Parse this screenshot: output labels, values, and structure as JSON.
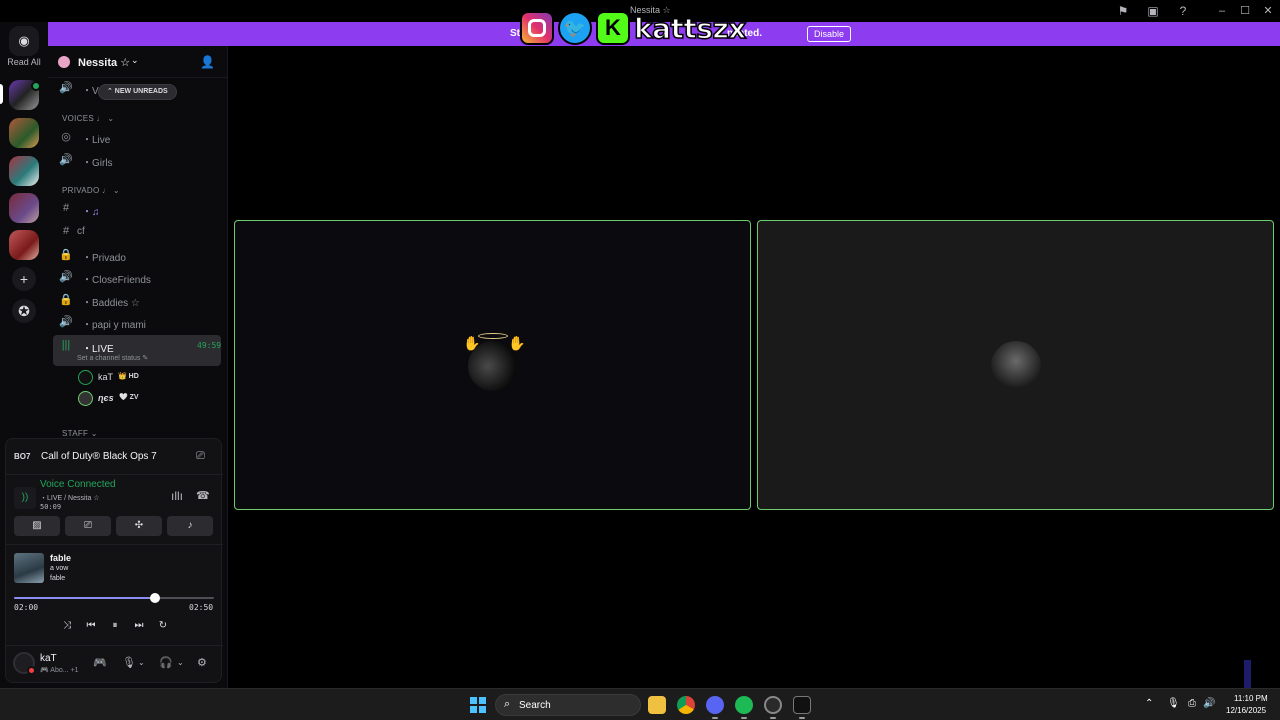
{
  "window": {
    "title": "Nessita ☆"
  },
  "notice": {
    "text_start": "St",
    "text_end": "ncated.",
    "disable_label": "Disable",
    "close_icon": "×"
  },
  "overlay": {
    "name": "kattszx",
    "kick_letter": "K",
    "twitter_icon": "bird-icon",
    "instagram_icon": "camera-icon"
  },
  "rail": {
    "read_all": "Read All",
    "add_icon": "+",
    "discover_icon": "✪"
  },
  "server": {
    "name": "Nessita",
    "star": "☆"
  },
  "new_unreads": "⌃ NEW UNREADS",
  "channels": {
    "vo": "・Vo",
    "voices_cat": "VOICES ♩ ⌄",
    "live_stage": "・Live",
    "girls": "・Girls",
    "privado_cat": "PRIVADO ♩ ⌄",
    "music": "・♫",
    "cf": "cf",
    "privado": "・Privado",
    "closefriends": "・CloseFriends",
    "baddies": "・Baddies ☆",
    "papi": "・papi y mami",
    "live": "・LIVE",
    "live_timer": "49:59",
    "live_status": "Set a channel status ✎",
    "staff_cat": "STAFF ⌄"
  },
  "voice_users": [
    {
      "name": "kaT",
      "tag": "👑 HD"
    },
    {
      "name": "ɳєѕ",
      "tag": "🤍 ZV"
    }
  ],
  "game": {
    "logo": "BO7",
    "title": "Call of Duty® Black Ops 7"
  },
  "voice": {
    "status": "Voice Connected",
    "channel": "・LIVE / Nessita ☆",
    "elapsed": "50:09"
  },
  "music": {
    "title": "fable",
    "artist": "a vow",
    "album": "fable",
    "current": "02:00",
    "total": "02:50",
    "progress": 0.705
  },
  "user": {
    "name": "kaT",
    "activity": "🎮 Abo... +1"
  },
  "taskbar": {
    "search_label": "Search",
    "time": "11:10 PM",
    "date": "12/16/2025"
  },
  "colors": {
    "accent": "#8d3cf0",
    "online": "#23a55a",
    "tile_border": "#6ecc6e",
    "progress": "#8c8cf5"
  }
}
